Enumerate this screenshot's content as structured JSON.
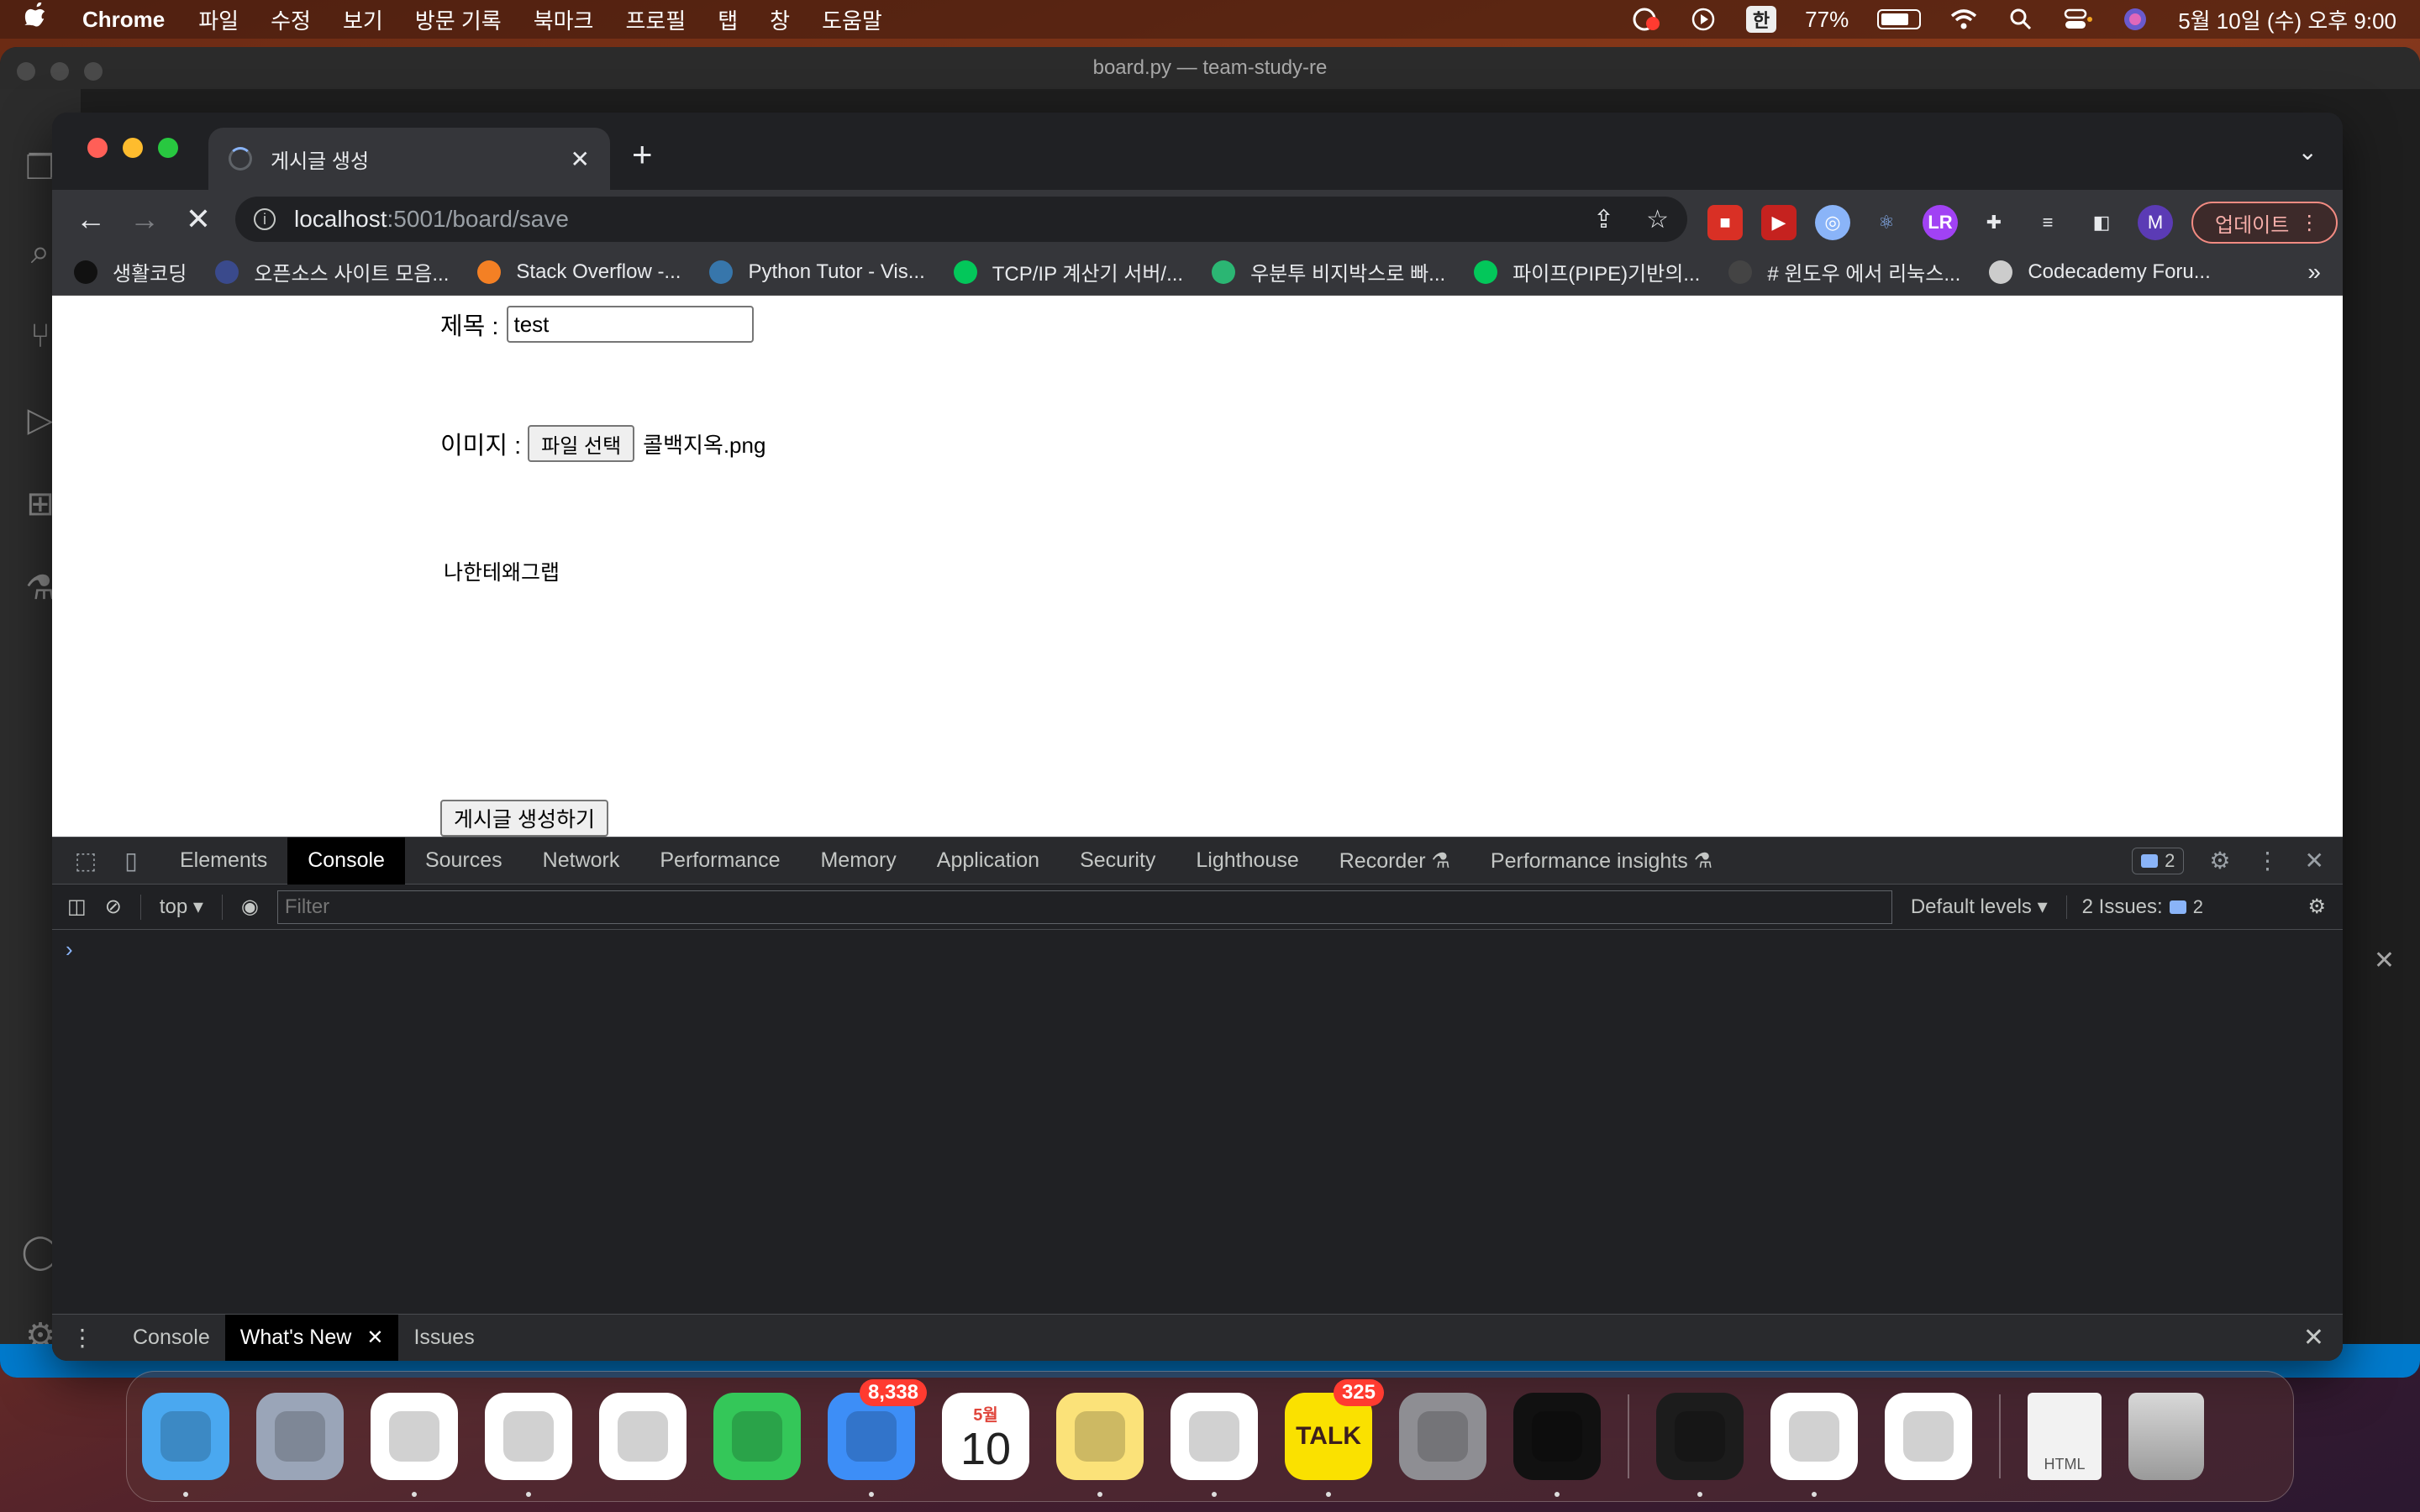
{
  "menubar": {
    "app_name": "Chrome",
    "menus": [
      "파일",
      "수정",
      "보기",
      "방문 기록",
      "북마크",
      "프로필",
      "탭",
      "창",
      "도움말"
    ],
    "input_source": "한",
    "battery": "77%",
    "battery_level": 0.77,
    "datetime": "5월 10일 (수) 오후 9:00"
  },
  "vscode": {
    "title": "board.py — team-study-re"
  },
  "chrome": {
    "tab": {
      "title": "게시글 생성"
    },
    "omnibox": {
      "host": "localhost",
      "path": ":5001/board/save"
    },
    "update_label": "업데이트",
    "profile_initial": "M",
    "bookmarks": [
      {
        "label": "생활코딩",
        "color": "#111111"
      },
      {
        "label": "오픈소스 사이트 모음...",
        "color": "#3a4a8c"
      },
      {
        "label": "Stack Overflow -...",
        "color": "#f48024"
      },
      {
        "label": "Python Tutor - Vis...",
        "color": "#3776ab"
      },
      {
        "label": "TCP/IP 계산기 서버/...",
        "color": "#03c75a"
      },
      {
        "label": "우분투 비지박스로 빠...",
        "color": "#2bb673"
      },
      {
        "label": "파이프(PIPE)기반의...",
        "color": "#03c75a"
      },
      {
        "label": "# 윈도우 에서 리눅스...",
        "color": "#444444"
      },
      {
        "label": "Codecademy Foru...",
        "color": "#cccccc"
      }
    ]
  },
  "page": {
    "title_label": "제목 :",
    "title_value": "test",
    "image_label": "이미지 :",
    "file_button": "파일 선택",
    "file_name": "콜백지옥.png",
    "content_text": "나한테왜그랩",
    "submit_button": "게시글 생성하기"
  },
  "devtools": {
    "tabs": [
      "Elements",
      "Console",
      "Sources",
      "Network",
      "Performance",
      "Memory",
      "Application",
      "Security",
      "Lighthouse",
      "Recorder ⚗",
      "Performance insights ⚗"
    ],
    "active_tab": "Console",
    "issue_count": "2",
    "context": "top",
    "filter_placeholder": "Filter",
    "levels": "Default levels",
    "issues_label": "2 Issues:",
    "issues_count": "2",
    "prompt": "›",
    "drawer_tabs": [
      "Console",
      "What's New",
      "Issues"
    ]
  },
  "dock": {
    "apps": [
      {
        "name": "Finder",
        "color": "#4aa8f0",
        "running": true
      },
      {
        "name": "Launchpad",
        "color": "#9aa5b8",
        "running": false
      },
      {
        "name": "Chrome",
        "color": "#ffffff",
        "running": true
      },
      {
        "name": "VS Code",
        "color": "#ffffff",
        "running": true
      },
      {
        "name": "Safari",
        "color": "#ffffff",
        "running": false
      },
      {
        "name": "Messages",
        "color": "#34c759",
        "running": false
      },
      {
        "name": "Mail",
        "color": "#3d8ef7",
        "running": true,
        "badge": "8,338"
      },
      {
        "name": "Calendar",
        "color": "#ffffff",
        "running": false,
        "month": "5월",
        "day": "10"
      },
      {
        "name": "Notes",
        "color": "#fbe279",
        "running": true
      },
      {
        "name": "Slack",
        "color": "#ffffff",
        "running": true
      },
      {
        "name": "KakaoTalk",
        "color": "#fae100",
        "running": true,
        "badge": "325",
        "label": "TALK"
      },
      {
        "name": "System Settings",
        "color": "#8e8e93",
        "running": false
      },
      {
        "name": "iTerm",
        "color": "#111111",
        "running": true
      }
    ],
    "apps2": [
      {
        "name": "Terminal",
        "color": "#1c1c1c",
        "running": true
      },
      {
        "name": "MongoDB Compass",
        "color": "#ffffff",
        "running": true
      },
      {
        "name": "VS Code",
        "color": "#ffffff",
        "running": false
      }
    ],
    "doc_label": "HTML"
  }
}
